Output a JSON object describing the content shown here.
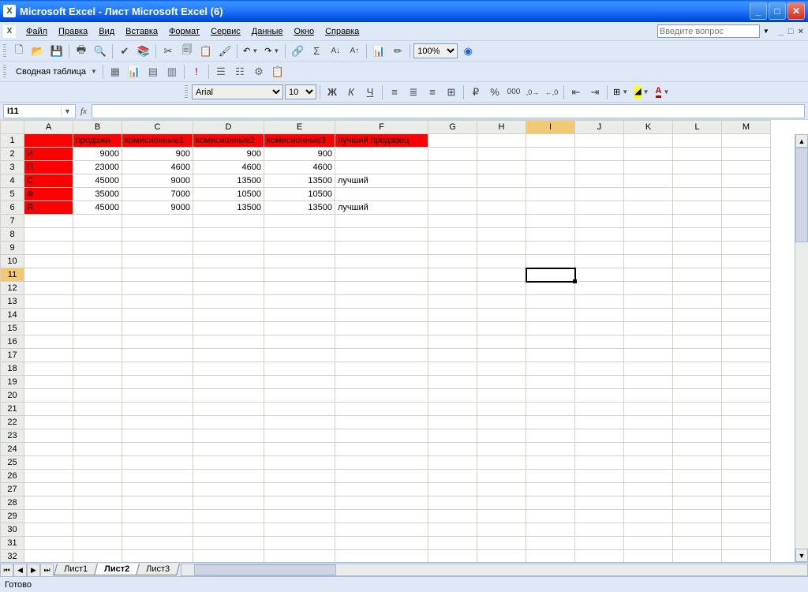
{
  "window": {
    "title": "Microsoft Excel - Лист Microsoft Excel (6)"
  },
  "menu": {
    "items": [
      "Файл",
      "Правка",
      "Вид",
      "Вставка",
      "Формат",
      "Сервис",
      "Данные",
      "Окно",
      "Справка"
    ],
    "question_placeholder": "Введите вопрос"
  },
  "toolbar_main": {
    "zoom": "100%"
  },
  "toolbar_pivot": {
    "label": "Сводная таблица"
  },
  "toolbar_format": {
    "font": "Arial",
    "size": "10"
  },
  "namebox": {
    "cell": "I11"
  },
  "columns": [
    "A",
    "B",
    "C",
    "D",
    "E",
    "F",
    "G",
    "H",
    "I",
    "J",
    "K",
    "L",
    "M"
  ],
  "active_col": "I",
  "active_row": 11,
  "sheet": {
    "headers": {
      "B": "продажи",
      "C": "комисионные1",
      "D": "комисионные2",
      "E": "комисионные3",
      "F": "лучший продавец"
    },
    "rows": [
      {
        "A": "И",
        "B": 9000,
        "C": 900,
        "D": 900,
        "E": 900,
        "F": ""
      },
      {
        "A": "П",
        "B": 23000,
        "C": 4600,
        "D": 4600,
        "E": 4600,
        "F": ""
      },
      {
        "A": "С",
        "B": 45000,
        "C": 9000,
        "D": 13500,
        "E": 13500,
        "F": "лучший"
      },
      {
        "A": "Ф",
        "B": 35000,
        "C": 7000,
        "D": 10500,
        "E": 10500,
        "F": ""
      },
      {
        "A": "Я",
        "B": 45000,
        "C": 9000,
        "D": 13500,
        "E": 13500,
        "F": "лучший"
      }
    ]
  },
  "sheets": {
    "tabs": [
      "Лист1",
      "Лист2",
      "Лист3"
    ],
    "active": 1
  },
  "status": {
    "text": "Готово"
  }
}
